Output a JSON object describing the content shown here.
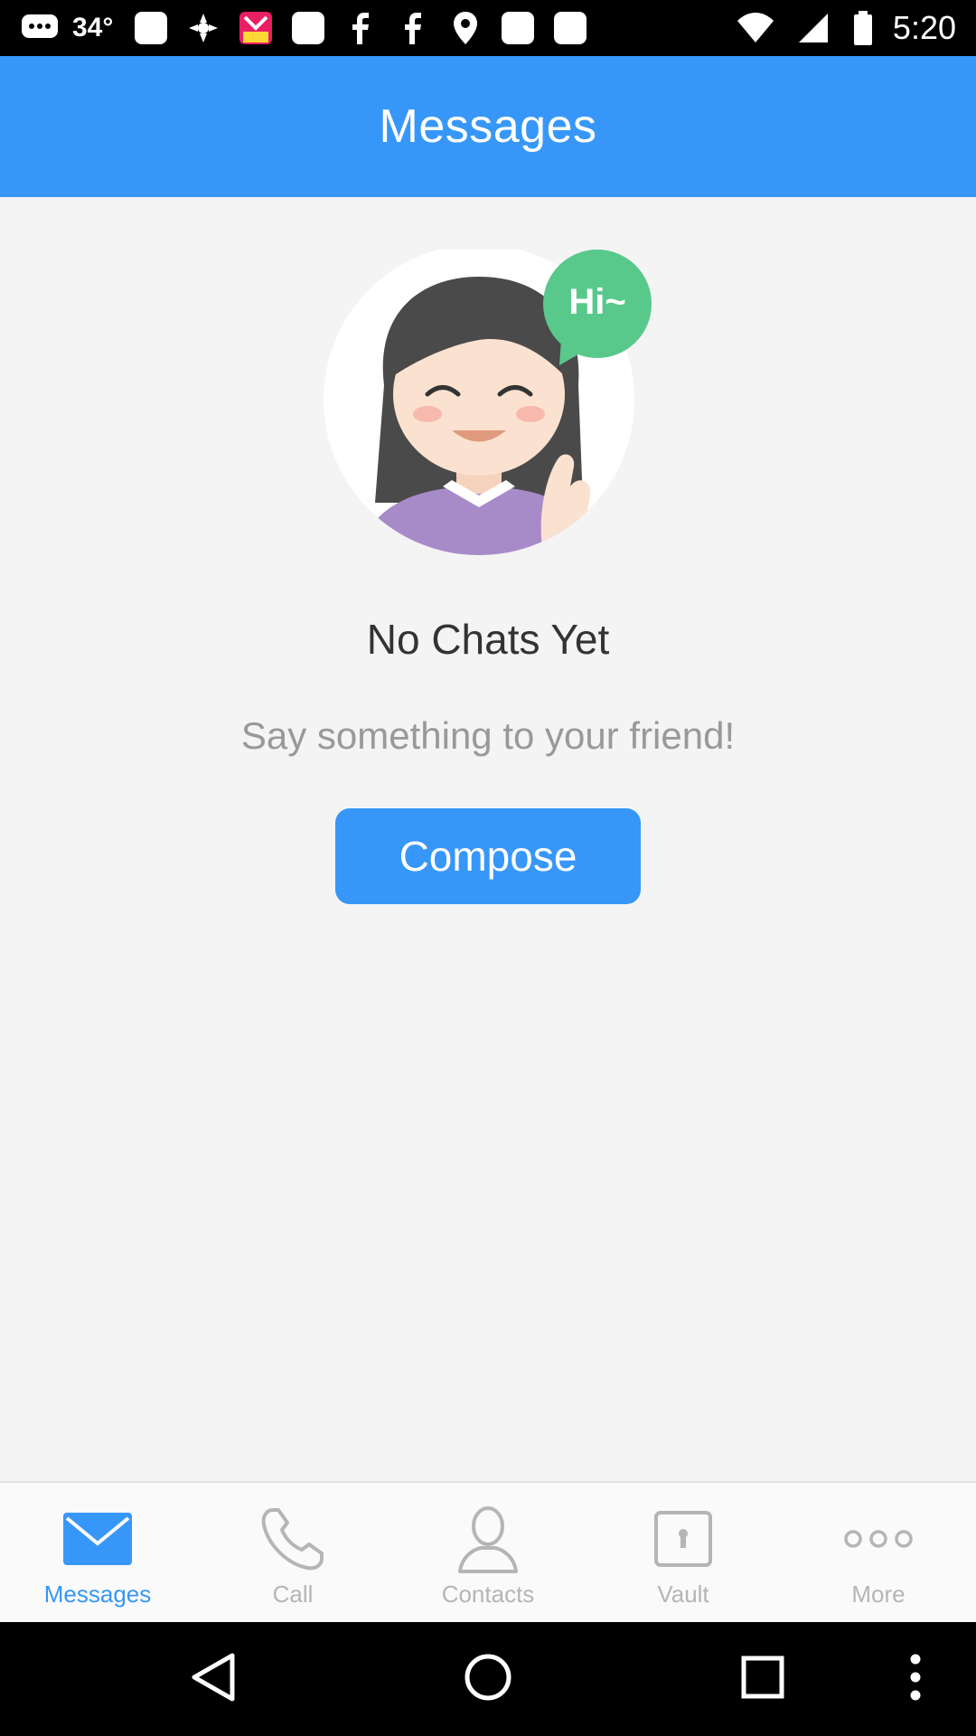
{
  "status_bar": {
    "temperature": "34°",
    "time": "5:20",
    "icons": [
      "chat-bubble-icon",
      "square-notification-icon",
      "pinwheel-icon",
      "pop-app-icon",
      "square-notification-icon",
      "facebook-icon",
      "facebook-icon",
      "location-pin-icon",
      "square-notification-icon",
      "square-notification-icon"
    ]
  },
  "app_bar": {
    "title": "Messages"
  },
  "illustration": {
    "speech_bubble": "Hi~",
    "colors": {
      "bubble": "#58c98a",
      "sweater": "#a78bc9",
      "hair": "#4a4a4a",
      "skin": "#fbe2d0"
    }
  },
  "empty_state": {
    "title": "No Chats Yet",
    "subtitle": "Say something to your friend!",
    "compose_label": "Compose"
  },
  "tab_bar": {
    "active_color": "#3797f9",
    "inactive_color": "#b5b5b5",
    "tabs": [
      {
        "label": "Messages",
        "icon": "envelope-icon",
        "active": true
      },
      {
        "label": "Call",
        "icon": "phone-icon",
        "active": false
      },
      {
        "label": "Contacts",
        "icon": "person-icon",
        "active": false
      },
      {
        "label": "Vault",
        "icon": "lock-icon",
        "active": false
      },
      {
        "label": "More",
        "icon": "more-dots-icon",
        "active": false
      }
    ]
  },
  "nav_bar": {
    "buttons": [
      "back-icon",
      "home-icon",
      "recents-icon",
      "menu-icon"
    ]
  }
}
